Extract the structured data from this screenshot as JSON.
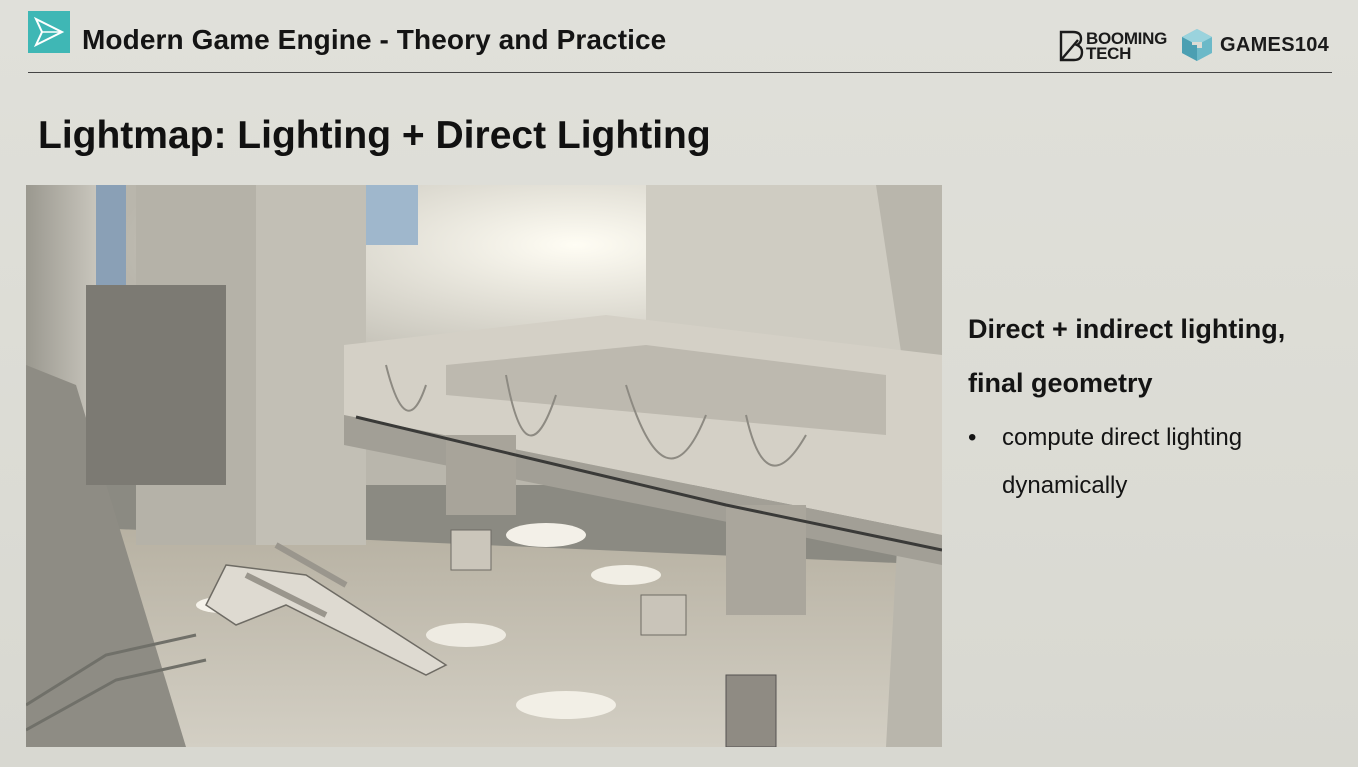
{
  "header": {
    "course_title": "Modern Game Engine - Theory and Practice",
    "brand_booming_line1": "BOOMING",
    "brand_booming_line2": "TECH",
    "brand_games": "GAMES104"
  },
  "slide": {
    "title": "Lightmap: Lighting + Direct Lighting",
    "heading_line1": "Direct + indirect lighting,",
    "heading_line2": "final geometry",
    "bullets": [
      {
        "marker": "•",
        "text": "compute direct lighting dynamically"
      }
    ]
  },
  "colors": {
    "accent": "#3fb7b5",
    "background": "#dcdcd5",
    "text": "#141414"
  },
  "icons": {
    "logo": "paper-plane-icon",
    "booming": "booming-b-logo",
    "games": "games-cube-logo"
  }
}
